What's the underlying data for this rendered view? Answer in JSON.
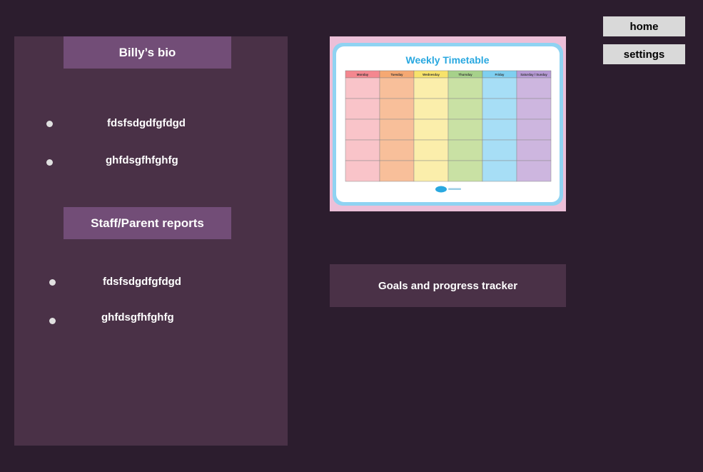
{
  "nav": {
    "home_label": "home",
    "settings_label": "settings"
  },
  "bio": {
    "title": "Billy’s bio",
    "items": [
      "fdsfsdgdfgfdgd",
      "ghfdsgfhfghfg"
    ]
  },
  "reports": {
    "title": "Staff/Parent reports",
    "items": [
      "fdsfsdgdfgfdgd",
      "ghfdsgfhfghfg"
    ]
  },
  "timetable": {
    "title": "Weekly Timetable",
    "days": [
      "Monday",
      "Tuesday",
      "Wednesday",
      "Thursday",
      "Friday",
      "Saturday / Sunday"
    ],
    "day_colors": [
      "#f4878f",
      "#f5a872",
      "#f7e26b",
      "#a6d18a",
      "#7fcff0",
      "#b79bd6"
    ],
    "cell_colors": [
      "#f9c4c9",
      "#f8bf9a",
      "#fbeeab",
      "#c9e1a4",
      "#a7def6",
      "#cdb6df"
    ],
    "rows": 5,
    "accent": "#29a8e0"
  },
  "goals": {
    "label": "Goals and progress tracker"
  }
}
